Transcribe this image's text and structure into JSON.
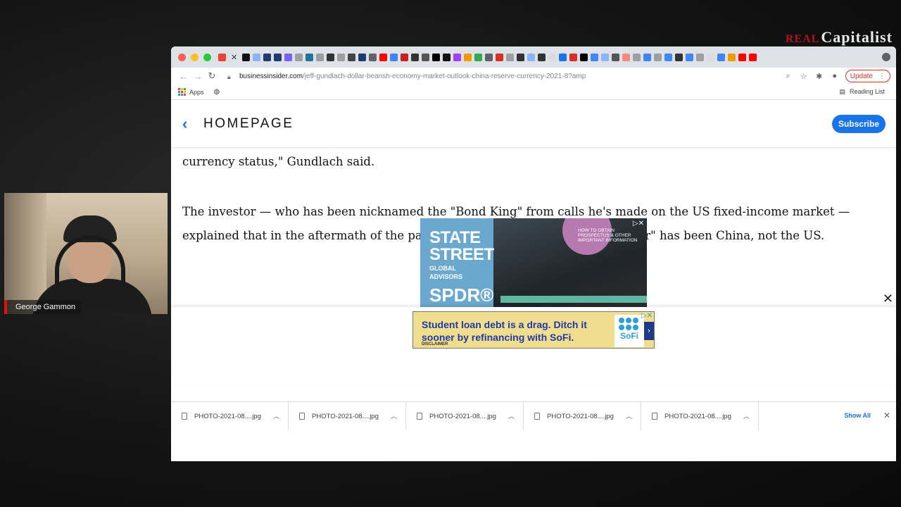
{
  "overlay": {
    "logo_prefix": "REAL",
    "logo_text": "Capitalist",
    "webcam_name": "George Gammon"
  },
  "browser": {
    "url_domain": "businessinsider.com",
    "url_path": "/jeff-gundlach-dollar-bearish-economy-market-outlook-china-reserve-currency-2021-8?amp",
    "update_label": "Update",
    "bookmarks": {
      "apps_label": "Apps",
      "reading_list_label": "Reading List"
    }
  },
  "page": {
    "header": {
      "title": "HOMEPAGE",
      "subscribe_label": "Subscribe"
    },
    "article": {
      "line1": "currency status,\" Gundlach said.",
      "para2": "The investor — who has been nicknamed the \"Bond King\" from calls he's made on the US fixed-income market — explained that in the aftermath of the pandemic, the strongest economy \"by far\" has been China, not the US."
    },
    "ad_state_street": {
      "brand_line1": "STATE",
      "brand_line2": "STREET",
      "brand_small1": "GLOBAL",
      "brand_small2": "ADVISORS",
      "brand_spdr": "SPDR®",
      "info_text": "HOW TO OBTAIN PROSPECTUS & OTHER IMPORTANT INFORMATION"
    },
    "ad_sofi": {
      "message": "Student loan debt is a drag. Ditch it sooner by refinancing with SoFi.",
      "disclaimer": "DISCLAIMER",
      "logo_text": "SoFi"
    }
  },
  "downloads": {
    "items": [
      {
        "filename": "PHOTO-2021-08....jpg"
      },
      {
        "filename": "PHOTO-2021-08....jpg"
      },
      {
        "filename": "PHOTO-2021-08....jpg"
      },
      {
        "filename": "PHOTO-2021-08....jpg"
      },
      {
        "filename": "PHOTO-2021-08....jpg"
      }
    ],
    "show_all_label": "Show All"
  },
  "colors": {
    "accent": "#1a73e8",
    "update_red": "#d93025",
    "sofi_bg": "#f1dd8e",
    "sofi_text": "#1e3aa8"
  },
  "icons": {
    "back": "chevron-left-icon",
    "close": "close-icon",
    "search": "search-icon",
    "star": "star-icon",
    "extensions": "puzzle-icon"
  }
}
